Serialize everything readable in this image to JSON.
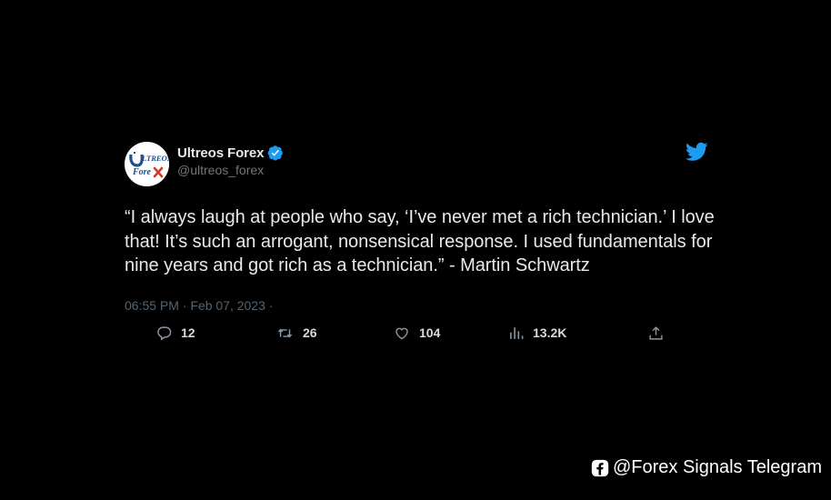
{
  "tweet": {
    "display_name": "Ultreos Forex",
    "handle": "@ultreos_forex",
    "text": "“I always laugh at people who say, ‘I’ve never met a rich technician.’ I love that! It’s such an arrogant, nonsensical response. I used fundamentals for nine years and got rich as a technician.” - Martin Schwartz",
    "timestamp": "06:55 PM · Feb 07, 2023 ·",
    "avatar": {
      "logo_text_top": "LTREOS",
      "logo_text_bottom": "Fore"
    }
  },
  "actions": {
    "reply_count": "12",
    "retweet_count": "26",
    "like_count": "104",
    "views_count": "13.2K"
  },
  "watermark": {
    "text": "@Forex Signals Telegram"
  },
  "icons": {
    "verified": "verified-badge-icon",
    "brand": "twitter-bird-icon",
    "reply": "reply-icon",
    "retweet": "retweet-icon",
    "like": "heart-icon",
    "views": "views-chart-icon",
    "share": "share-icon",
    "watermark": "facebook-icon"
  },
  "colors": {
    "background": "#000000",
    "text": "#e7e9ea",
    "secondary": "#71767b",
    "twitter_blue": "#1d9bf0",
    "logo_blue": "#1f4f8c",
    "logo_red": "#d63a2c"
  }
}
